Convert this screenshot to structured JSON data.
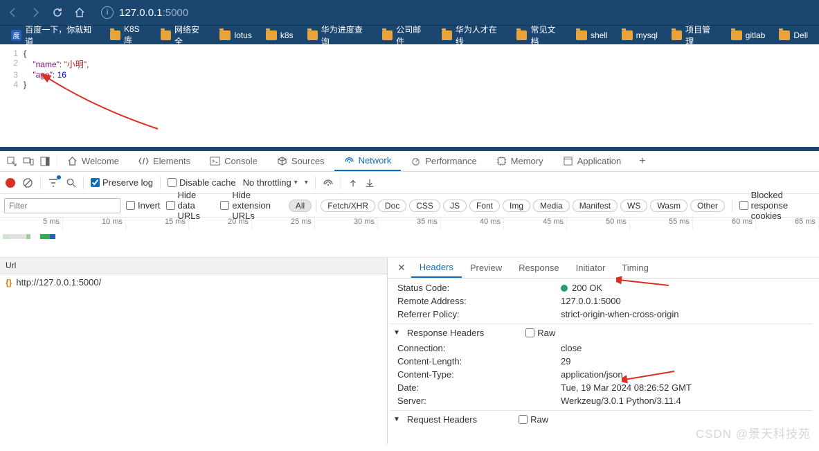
{
  "browser": {
    "url_host": "127.0.0.1",
    "url_port": ":5000",
    "bookmarks": [
      {
        "label": "百度一下，你就知道",
        "icon": "baidu"
      },
      {
        "label": "K8S库",
        "icon": "folder"
      },
      {
        "label": "网络安全",
        "icon": "folder"
      },
      {
        "label": "lotus",
        "icon": "folder"
      },
      {
        "label": "k8s",
        "icon": "folder"
      },
      {
        "label": "华为进度查询",
        "icon": "folder"
      },
      {
        "label": "公司邮件",
        "icon": "folder"
      },
      {
        "label": "华为人才在线",
        "icon": "folder"
      },
      {
        "label": "常见文档",
        "icon": "folder"
      },
      {
        "label": "shell",
        "icon": "folder"
      },
      {
        "label": "mysql",
        "icon": "folder"
      },
      {
        "label": "项目管理",
        "icon": "folder"
      },
      {
        "label": "gitlab",
        "icon": "folder"
      },
      {
        "label": "Dell",
        "icon": "folder"
      }
    ]
  },
  "page_json": {
    "lines": [
      "{",
      "    \"name\": \"小明\",",
      "    \"age\": 16",
      "}"
    ]
  },
  "devtools": {
    "tabs": [
      "Welcome",
      "Elements",
      "Console",
      "Sources",
      "Network",
      "Performance",
      "Memory",
      "Application"
    ],
    "active_tab": "Network"
  },
  "net_toolbar": {
    "preserve_log_label": "Preserve log",
    "disable_cache_label": "Disable cache",
    "throttling_label": "No throttling"
  },
  "filter_bar": {
    "placeholder": "Filter",
    "invert": "Invert",
    "hide_data": "Hide data URLs",
    "hide_ext": "Hide extension URLs",
    "types": [
      "All",
      "Fetch/XHR",
      "Doc",
      "CSS",
      "JS",
      "Font",
      "Img",
      "Media",
      "Manifest",
      "WS",
      "Wasm",
      "Other"
    ],
    "blocked_cookies": "Blocked response cookies"
  },
  "timeline": {
    "ticks": [
      "5 ms",
      "10 ms",
      "15 ms",
      "20 ms",
      "25 ms",
      "30 ms",
      "35 ms",
      "40 ms",
      "45 ms",
      "50 ms",
      "55 ms",
      "60 ms",
      "65 ms"
    ]
  },
  "requests": {
    "header": "Url",
    "items": [
      {
        "url": "http://127.0.0.1:5000/"
      }
    ]
  },
  "details": {
    "tabs": [
      "Headers",
      "Preview",
      "Response",
      "Initiator",
      "Timing"
    ],
    "active": "Headers",
    "general": [
      {
        "k": "Status Code:",
        "v": "200 OK",
        "status": true
      },
      {
        "k": "Remote Address:",
        "v": "127.0.0.1:5000"
      },
      {
        "k": "Referrer Policy:",
        "v": "strict-origin-when-cross-origin"
      }
    ],
    "response_section": "Response Headers",
    "raw_label": "Raw",
    "response_headers": [
      {
        "k": "Connection:",
        "v": "close"
      },
      {
        "k": "Content-Length:",
        "v": "29"
      },
      {
        "k": "Content-Type:",
        "v": "application/json"
      },
      {
        "k": "Date:",
        "v": "Tue, 19 Mar 2024 08:26:52 GMT"
      },
      {
        "k": "Server:",
        "v": "Werkzeug/3.0.1 Python/3.11.4"
      }
    ],
    "request_section": "Request Headers"
  },
  "watermark": "CSDN @景天科技苑"
}
